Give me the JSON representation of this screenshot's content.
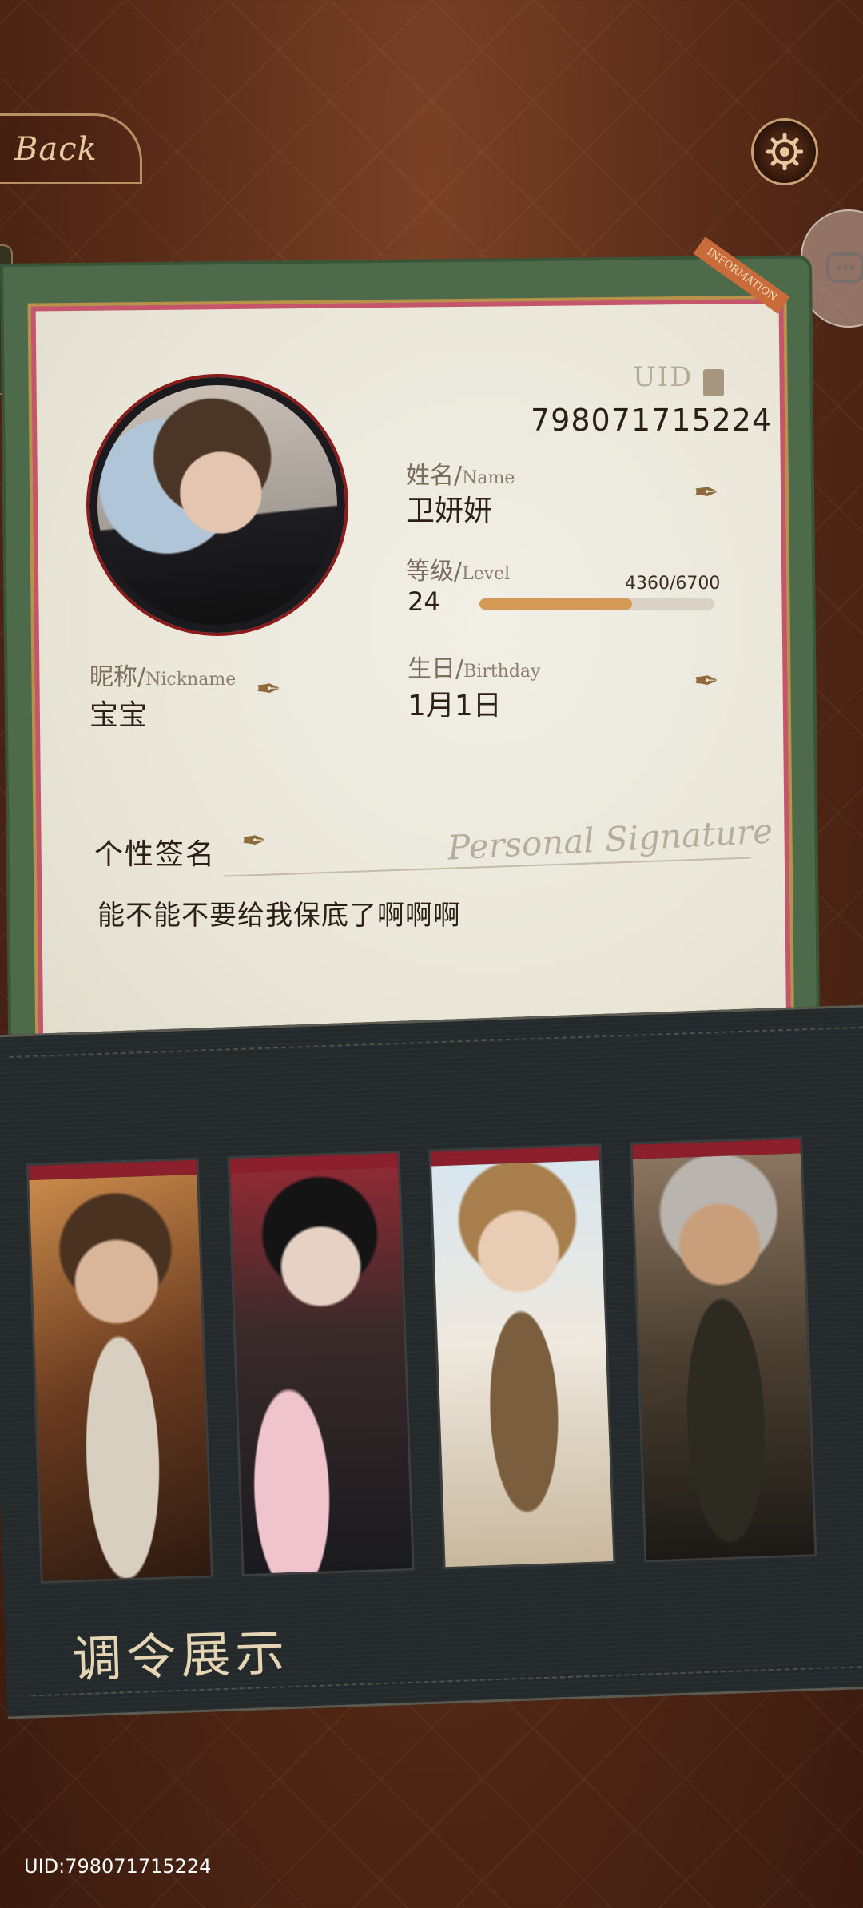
{
  "nav": {
    "back_label": "Back",
    "settings_icon": "gear-icon",
    "side_icon": "chat-icon"
  },
  "card": {
    "ribbon": "INFORMATION",
    "uid_label": "UID",
    "uid_value": "798071715224",
    "name": {
      "label_cn": "姓名/",
      "label_en": "Name",
      "value": "卫妍妍"
    },
    "level": {
      "label_cn": "等级/",
      "label_en": "Level",
      "value": "24",
      "progress_text": "4360/6700",
      "progress": 0.65
    },
    "nickname": {
      "label_cn": "昵称/",
      "label_en": "Nickname",
      "value": "宝宝"
    },
    "birthday": {
      "label_cn": "生日/",
      "label_en": "Birthday",
      "value": "1月1日"
    },
    "signature": {
      "title": "个性签名",
      "script": "Personal Signature",
      "text": "能不能不要给我保底了啊啊啊"
    }
  },
  "display": {
    "title": "调令展示",
    "cards": [
      {
        "name": "card-1"
      },
      {
        "name": "card-2"
      },
      {
        "name": "card-3"
      },
      {
        "name": "card-4"
      }
    ]
  },
  "footer": {
    "uid_text": "UID:798071715224"
  },
  "colors": {
    "accent": "#d49a55",
    "card_green": "#4d6b4a",
    "frame_red": "#8b1f2b"
  }
}
